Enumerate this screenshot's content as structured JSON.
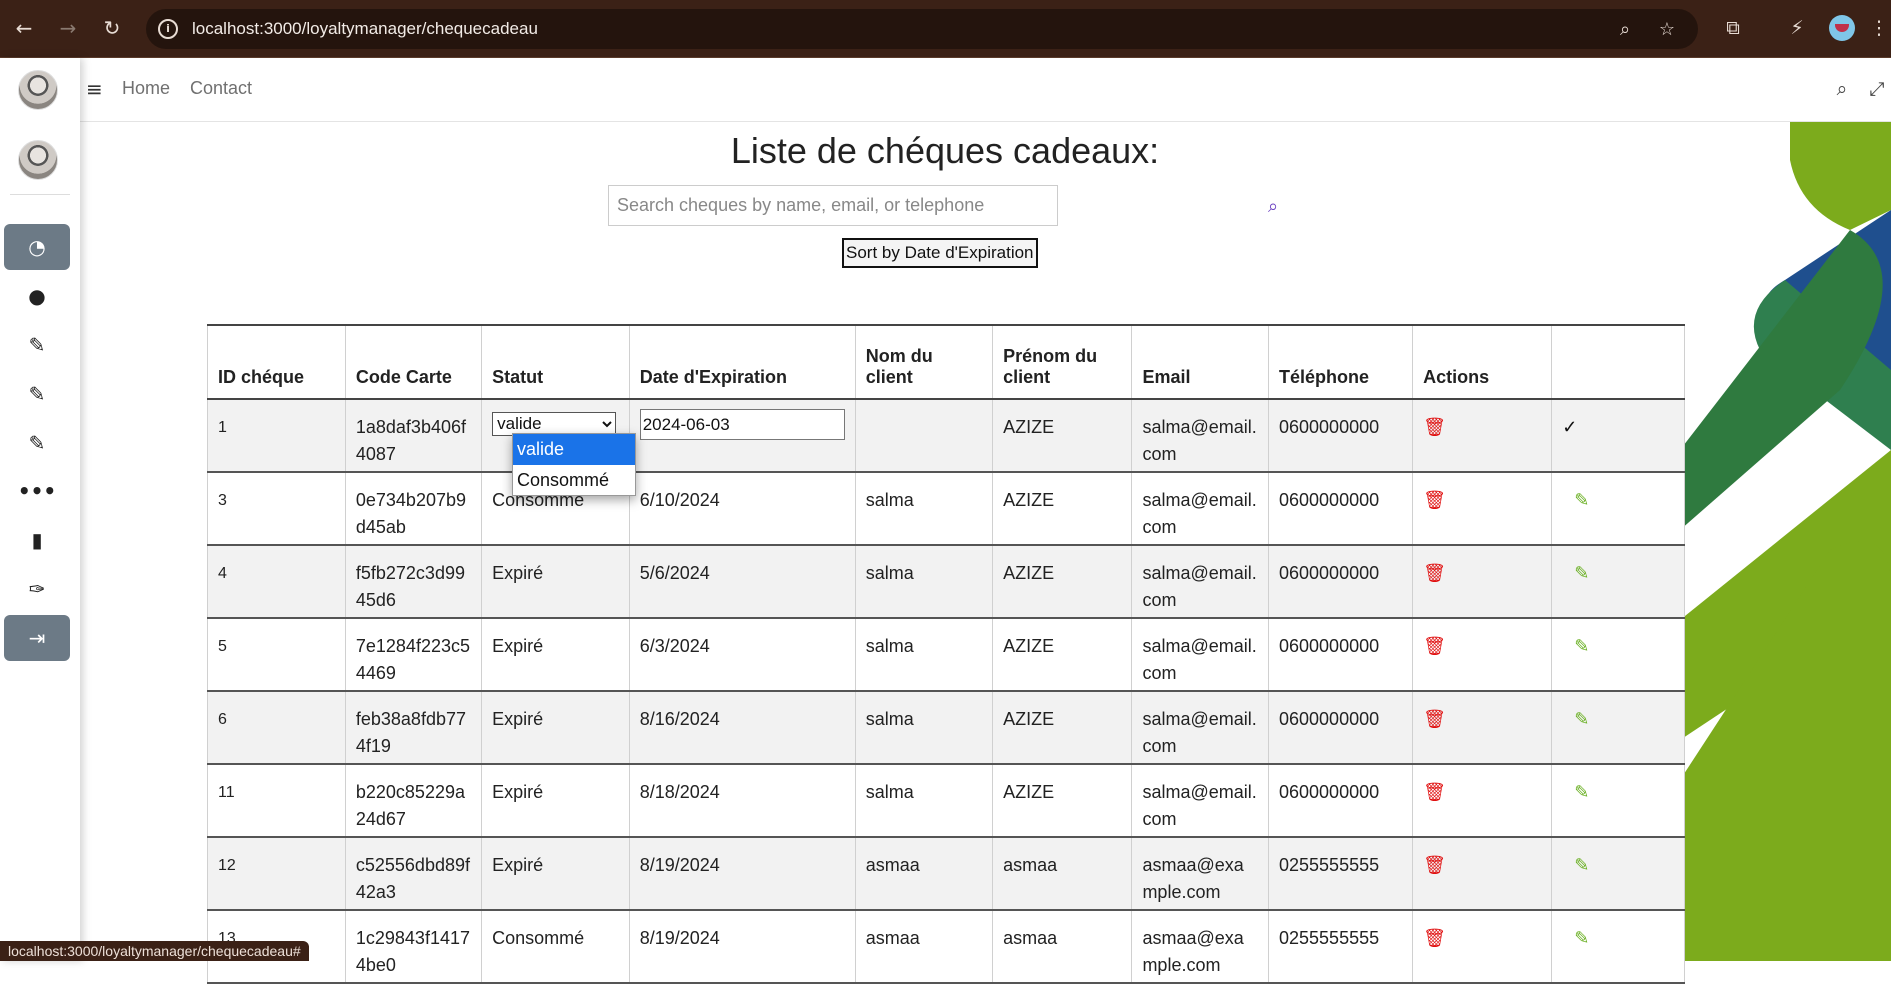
{
  "browser": {
    "url": "localhost:3000/loyaltymanager/chequecadeau",
    "status_url": "localhost:3000/loyaltymanager/chequecadeau#"
  },
  "topnav": {
    "home": "Home",
    "contact": "Contact"
  },
  "page": {
    "title": "Liste de chéques cadeaux:",
    "search_placeholder": "Search cheques by name, email, or telephone",
    "sort_label": "Sort by Date d'Expiration"
  },
  "table": {
    "headers": [
      "ID chéque",
      "Code Carte",
      "Statut",
      "Date d'Expiration",
      "Nom du client",
      "Prénom du client",
      "Email",
      "Téléphone",
      "Actions",
      ""
    ],
    "editing_row": {
      "id": "1",
      "code": "1a8daf3b406f4087",
      "status_value": "valide",
      "date_value": "2024-06-03",
      "nom": "",
      "prenom": "AZIZE",
      "email": "salma@email.com",
      "telephone": "0600000000"
    },
    "rows": [
      {
        "id": "3",
        "code": "0e734b207b9d45ab",
        "status": "Consommé",
        "date": "6/10/2024",
        "nom": "salma",
        "prenom": "AZIZE",
        "email": "salma@email.com",
        "telephone": "0600000000"
      },
      {
        "id": "4",
        "code": "f5fb272c3d9945d6",
        "status": "Expiré",
        "date": "5/6/2024",
        "nom": "salma",
        "prenom": "AZIZE",
        "email": "salma@email.com",
        "telephone": "0600000000"
      },
      {
        "id": "5",
        "code": "7e1284f223c54469",
        "status": "Expiré",
        "date": "6/3/2024",
        "nom": "salma",
        "prenom": "AZIZE",
        "email": "salma@email.com",
        "telephone": "0600000000"
      },
      {
        "id": "6",
        "code": "feb38a8fdb774f19",
        "status": "Expiré",
        "date": "8/16/2024",
        "nom": "salma",
        "prenom": "AZIZE",
        "email": "salma@email.com",
        "telephone": "0600000000"
      },
      {
        "id": "11",
        "code": "b220c85229a24d67",
        "status": "Expiré",
        "date": "8/18/2024",
        "nom": "salma",
        "prenom": "AZIZE",
        "email": "salma@email.com",
        "telephone": "0600000000"
      },
      {
        "id": "12",
        "code": "c52556dbd89f42a3",
        "status": "Expiré",
        "date": "8/19/2024",
        "nom": "asmaa",
        "prenom": "asmaa",
        "email": "asmaa@example.com",
        "telephone": "0255555555"
      },
      {
        "id": "13",
        "code": "1c29843f14174be0",
        "status": "Consommé",
        "date": "8/19/2024",
        "nom": "asmaa",
        "prenom": "asmaa",
        "email": "asmaa@example.com",
        "telephone": "0255555555"
      }
    ]
  },
  "dropdown": {
    "options": [
      "valide",
      "Consommé"
    ],
    "selected": "valide"
  },
  "colors": {
    "delete": "#e01010",
    "edit": "#6ab023",
    "accent": "#1a73e8",
    "sidebar_active": "#6c7a86"
  }
}
